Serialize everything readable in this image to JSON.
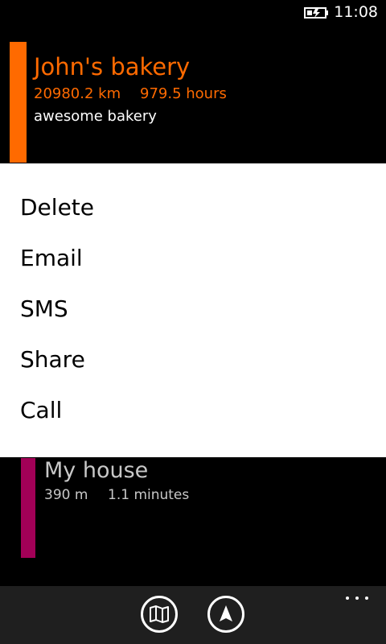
{
  "status_bar": {
    "time": "11:08",
    "battery_icon": "battery-charging-icon"
  },
  "selected_item": {
    "title": "John's bakery",
    "distance": "20980.2 km",
    "duration": "979.5 hours",
    "description": "awesome bakery",
    "accent_color": "#FF6A00"
  },
  "context_menu": {
    "items": [
      "Delete",
      "Email",
      "SMS",
      "Share",
      "Call"
    ]
  },
  "list_item": {
    "title": "My house",
    "distance": "390 m",
    "duration": "1.1 minutes",
    "accent_color": "#A20057"
  },
  "app_bar": {
    "buttons": [
      {
        "icon": "map-icon"
      },
      {
        "icon": "navigation-arrow-icon"
      }
    ],
    "more_icon": "more-dots-icon"
  }
}
